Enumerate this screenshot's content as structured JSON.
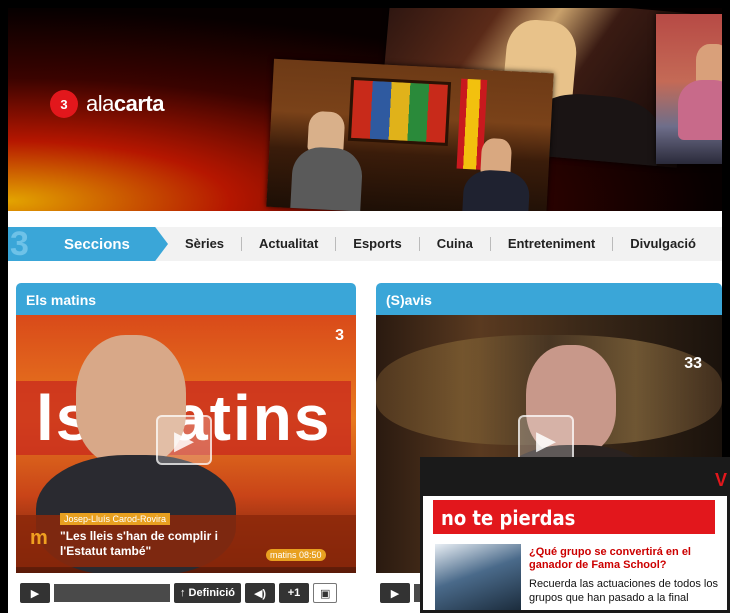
{
  "header": {
    "logo_mark": "3",
    "logo_prefix": "ala",
    "logo_suffix": "carta"
  },
  "nav": {
    "sections_label": "Seccions",
    "sections_mark": "3",
    "items": [
      "Sèries",
      "Actualitat",
      "Esports",
      "Cuina",
      "Entreteniment",
      "Divulgació"
    ]
  },
  "panels": [
    {
      "title": "Els matins",
      "channel": "3",
      "screen_text": "ls matins",
      "caption_mark": "m",
      "caption_name": "Josep-Lluís Carod-Rovira",
      "caption_quote_1": "\"Les lleis s'han de complir i",
      "caption_quote_2": "l'Estatut també\"",
      "caption_logo": "matins 08:50"
    },
    {
      "title": "(S)avis",
      "channel": "33"
    }
  ],
  "controls": {
    "play": "▶",
    "definition": "↑ Definició",
    "volume": "◀)",
    "plus": "+1",
    "fullscreen": "▣"
  },
  "promo": {
    "bar_letter": "V",
    "title": "no te pierdas",
    "link": "¿Qué grupo se convertirá en el ganador de Fama School?",
    "description": "Recuerda las actuaciones de todos los grupos que han pasado a la final"
  }
}
